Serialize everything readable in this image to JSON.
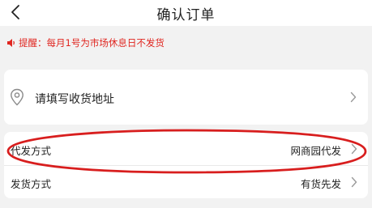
{
  "header": {
    "back_icon": "chevron-left-icon",
    "title": "确认订单"
  },
  "notice": {
    "icon": "speaker-icon",
    "text": "提醒：每月1号为市场休息日不发货",
    "color": "#e0251f"
  },
  "address": {
    "icon": "location-pin-icon",
    "label": "请填写收货地址"
  },
  "shipping": {
    "rows": [
      {
        "label": "代发方式",
        "value": "网商园代发"
      },
      {
        "label": "发货方式",
        "value": "有货先发"
      }
    ]
  },
  "annotation": {
    "shape": "ellipse",
    "color": "#d81e1e"
  }
}
